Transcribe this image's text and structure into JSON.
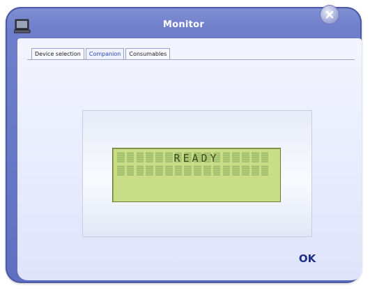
{
  "window": {
    "title": "Monitor"
  },
  "tabs": [
    {
      "label": "Device selection",
      "active": false
    },
    {
      "label": "Companion",
      "active": true
    },
    {
      "label": "Consumables",
      "active": false
    }
  ],
  "lcd": {
    "text": "READY",
    "color": "#c8dd86"
  },
  "buttons": {
    "ok_label": "OK"
  },
  "icons": {
    "app": "monitor-icon",
    "close": "close-icon"
  }
}
